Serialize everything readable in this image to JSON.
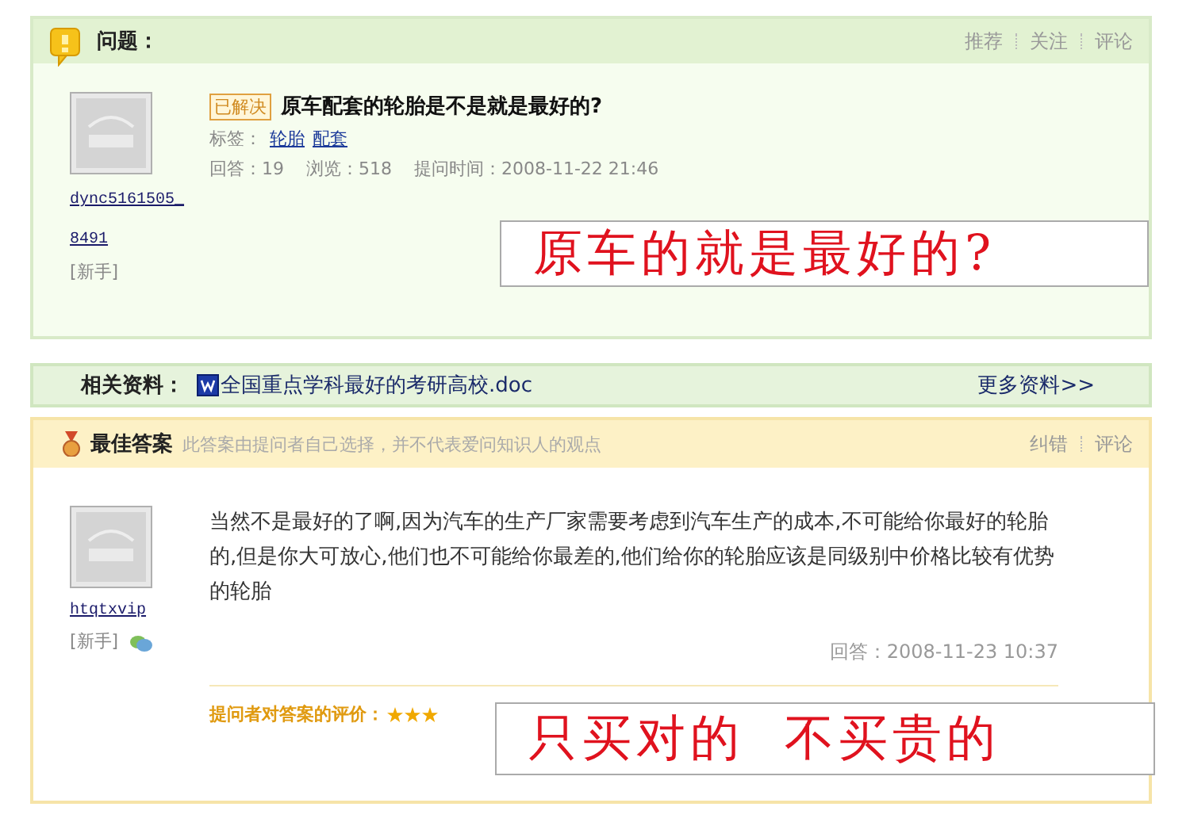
{
  "question": {
    "header_title": "问题：",
    "actions": [
      "推荐",
      "关注",
      "评论"
    ],
    "asker": {
      "name": "dync5161505_8491",
      "rank": "[新手]"
    },
    "status_badge": "已解决",
    "title": "原车配套的轮胎是不是就是最好的?",
    "tags_label": "标签：",
    "tags": [
      "轮胎",
      "配套"
    ],
    "meta": [
      "回答：19",
      "浏览：518",
      "提问时间：2008-11-22 21:46"
    ],
    "callout": "原车的就是最好的?"
  },
  "related": {
    "label": "相关资料：",
    "doc_link": "全国重点学科最好的考研高校.doc",
    "more": "更多资料>>"
  },
  "best_answer": {
    "header_title": "最佳答案",
    "note": "此答案由提问者自己选择，并不代表爱问知识人的观点",
    "actions": [
      "纠错",
      "评论"
    ],
    "answerer": {
      "name": "htqtxvip",
      "rank": "[新手]"
    },
    "body": "当然不是最好的了啊,因为汽车的生产厂家需要考虑到汽车生产的成本,不可能给你最好的轮胎的,但是你大可放心,他们也不可能给你最差的,他们给你的轮胎应该是同级别中价格比较有优势的轮胎",
    "answer_time": "回答：2008-11-23 10:37",
    "rating_label": "提问者对答案的评价：",
    "stars": 3,
    "callout": "只买对的  不买贵的"
  }
}
